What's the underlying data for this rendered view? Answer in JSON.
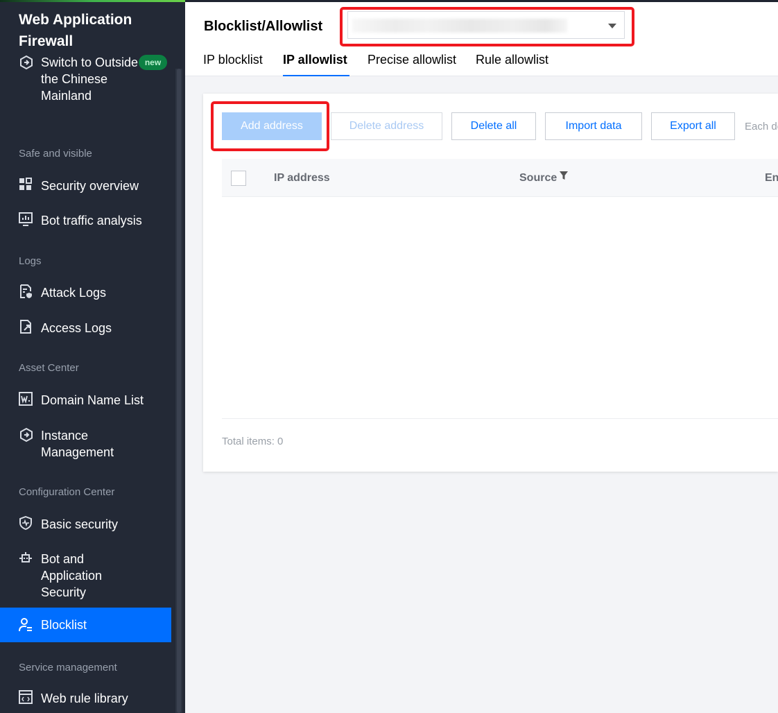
{
  "sidebar": {
    "brand": "Web Application Firewall",
    "switch_item": {
      "label": "Switch to Outside the Chinese Mainland",
      "badge": "new",
      "icon": "switch-icon"
    },
    "groups": [
      {
        "title": "Safe and visible",
        "items": [
          {
            "label": "Security overview",
            "icon": "grid-icon"
          },
          {
            "label": "Bot traffic analysis",
            "icon": "monitor-chart-icon"
          }
        ]
      },
      {
        "title": "Logs",
        "items": [
          {
            "label": "Attack Logs",
            "icon": "log-shield-icon"
          },
          {
            "label": "Access Logs",
            "icon": "log-access-icon"
          }
        ]
      },
      {
        "title": "Asset Center",
        "items": [
          {
            "label": "Domain Name List",
            "icon": "domain-icon"
          },
          {
            "label": "Instance Management",
            "icon": "instance-icon"
          }
        ]
      },
      {
        "title": "Configuration Center",
        "items": [
          {
            "label": "Basic security",
            "icon": "shield-icon"
          },
          {
            "label": "Bot and Application Security",
            "icon": "bot-icon"
          },
          {
            "label": "Blocklist",
            "icon": "user-list-icon",
            "active": true
          }
        ]
      },
      {
        "title": "Service management",
        "items": [
          {
            "label": "Web rule library",
            "icon": "library-icon"
          }
        ]
      }
    ]
  },
  "header": {
    "title": "Blocklist/Allowlist",
    "instance_select": {
      "value": "",
      "icon": "caret-down-icon"
    },
    "tabs": [
      {
        "label": "IP blocklist",
        "active": false
      },
      {
        "label": "IP allowlist",
        "active": true
      },
      {
        "label": "Precise allowlist",
        "active": false
      },
      {
        "label": "Rule allowlist",
        "active": false
      }
    ]
  },
  "toolbar": {
    "add": "Add address",
    "delete": "Delete address",
    "delete_all": "Delete all",
    "import": "Import data",
    "export": "Export all",
    "each_text": "Each de"
  },
  "table": {
    "columns": [
      "IP address",
      "Source",
      "En"
    ],
    "rows": [],
    "total": "Total items: 0"
  },
  "colors": {
    "accent": "#006eff",
    "sidebar_bg": "#232936",
    "highlight": "#f0181f",
    "new_badge": "#0c8043"
  }
}
